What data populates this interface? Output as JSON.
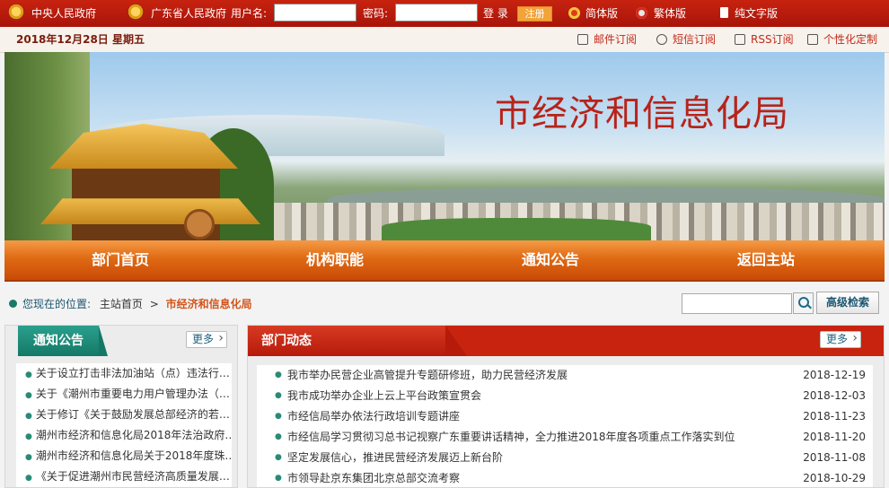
{
  "topbar": {
    "central_gov": "中央人民政府",
    "province_gov": "广东省人民政府",
    "username_label": "用户名:",
    "username_value": "",
    "password_label": "密码:",
    "password_value": "",
    "login": "登 录",
    "register": "注册",
    "simplified": "简体版",
    "traditional": "繁体版",
    "text_only": "纯文字版"
  },
  "datebar": {
    "date": "2018年12月28日  星期五",
    "links": [
      "邮件订阅",
      "短信订阅",
      "RSS订阅",
      "个性化定制"
    ]
  },
  "banner": {
    "title": "市经济和信息化局"
  },
  "nav": {
    "items": [
      "部门首页",
      "机构职能",
      "通知公告",
      "返回主站"
    ]
  },
  "location": {
    "label": "您现在的位置:",
    "home": "主站首页",
    "sep": ">",
    "current": "市经济和信息化局"
  },
  "search": {
    "value": "",
    "advanced": "高级检索"
  },
  "notices": {
    "title": "通知公告",
    "more": "更多",
    "items": [
      "关于设立打击非法加油站（点）违法行…",
      "关于《潮州市重要电力用户管理办法（…",
      "关于修订《关于鼓励发展总部经济的若…",
      "潮州市经济和信息化局2018年法治政府…",
      "潮州市经济和信息化局关于2018年度珠…",
      "《关于促进潮州市民营经济高质量发展…"
    ]
  },
  "news": {
    "title": "部门动态",
    "more": "更多",
    "items": [
      {
        "title": "我市举办民营企业高管提升专题研修班，助力民营经济发展",
        "date": "2018-12-19"
      },
      {
        "title": "我市成功举办企业上云上平台政策宣贯会",
        "date": "2018-12-03"
      },
      {
        "title": "市经信局举办依法行政培训专题讲座",
        "date": "2018-11-23"
      },
      {
        "title": "市经信局学习贯彻习总书记视察广东重要讲话精神，全力推进2018年度各项重点工作落实到位",
        "date": "2018-11-20"
      },
      {
        "title": "坚定发展信心，推进民营经济发展迈上新台阶",
        "date": "2018-11-08"
      },
      {
        "title": "市领导赴京东集团北京总部交流考察",
        "date": "2018-10-29"
      }
    ]
  },
  "colors": {
    "top_red": "#b51a10",
    "nav_orange": "#e06a14",
    "teal": "#157866",
    "accent_orange": "#d2541c"
  }
}
